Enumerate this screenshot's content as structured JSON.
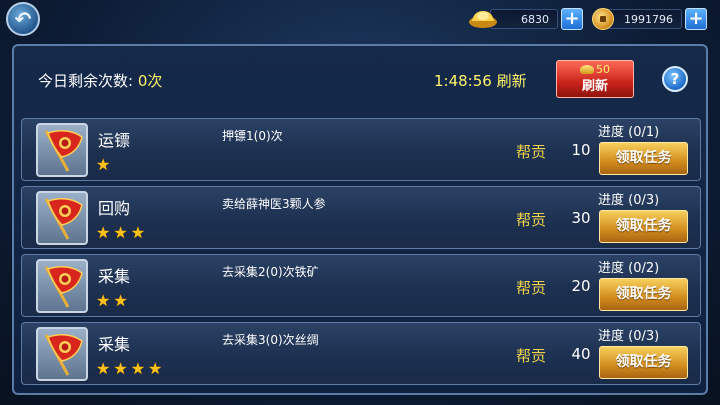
{
  "topbar": {
    "gold_amount": "6830",
    "coin_amount": "1991796",
    "plus_label": "+",
    "back_label": "↶"
  },
  "header": {
    "remain_label": "今日剩余次数:",
    "remain_value": "0次",
    "timer_text": "1:48:56 刷新",
    "refresh_cost": "50",
    "refresh_label": "刷新",
    "help_label": "?"
  },
  "tasks": [
    {
      "name": "运镖",
      "stars": 1,
      "desc": "押镖1(0)次",
      "contrib_label": "帮贡",
      "contrib": "10",
      "progress": "进度 (0/1)",
      "button": "领取任务"
    },
    {
      "name": "回购",
      "stars": 3,
      "desc": "卖给薛神医3颗人参",
      "contrib_label": "帮贡",
      "contrib": "30",
      "progress": "进度 (0/3)",
      "button": "领取任务"
    },
    {
      "name": "采集",
      "stars": 2,
      "desc": "去采集2(0)次铁矿",
      "contrib_label": "帮贡",
      "contrib": "20",
      "progress": "进度 (0/2)",
      "button": "领取任务"
    },
    {
      "name": "采集",
      "stars": 4,
      "desc": "去采集3(0)次丝绸",
      "contrib_label": "帮贡",
      "contrib": "40",
      "progress": "进度 (0/3)",
      "button": "领取任务"
    }
  ],
  "colors": {
    "accent_yellow": "#fff36a",
    "star": "#ffc21a",
    "refresh_red": "#c9231a",
    "accept_gold": "#d28d1e"
  },
  "icons": [
    "back-arrow-icon",
    "gold-ingot-icon",
    "copper-coin-icon",
    "plus-icon",
    "help-icon",
    "task-banner-icon",
    "star-icon"
  ]
}
